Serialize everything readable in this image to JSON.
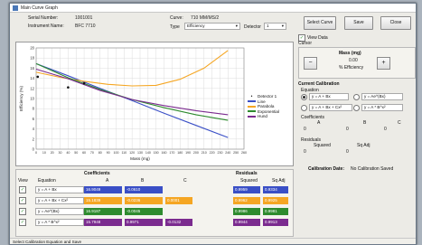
{
  "window": {
    "title": "Main Curve Graph"
  },
  "header": {
    "serial_label": "Serial Number:",
    "serial_value": "1001001",
    "instrument_label": "Instrument Name:",
    "instrument_value": "BFC 7710",
    "curve_label": "Curve:",
    "curve_value": "710 MM/MS/2",
    "type_label": "Type",
    "type_value": "Efficiency",
    "detector_label": "Detector",
    "detector_value": "1"
  },
  "toolbar": {
    "select_curve": "Select Curve",
    "save": "Save",
    "close": "Close"
  },
  "view": {
    "view_data_label": "View Data",
    "cursor_label": "Cursor",
    "mass_label": "Mass (mg)",
    "mass_value": "0.00",
    "efficiency_label": "% Efficiency",
    "minus": "−",
    "plus": "+"
  },
  "calibration": {
    "heading": "Current Calibration",
    "equation_label": "Equation",
    "options": [
      "y = A + Bx",
      "y = Ae^(Bx)",
      "y = A + Bx + Cx²",
      "y = A * B^x²"
    ],
    "coefficients_label": "Coefficients",
    "coef_headers": [
      "A",
      "B",
      "C"
    ],
    "coef_values": [
      "0",
      "0",
      "0"
    ],
    "residuals_label": "Residuals",
    "squared_label": "Squared",
    "sqadj_label": "Sq Adj",
    "squared_value": "0",
    "sqadj_value": "0",
    "date_label": "Calibration Date:",
    "date_value": "No Calibration Saved"
  },
  "table": {
    "coefficients_heading": "Coefficients",
    "residuals_heading": "Residuals",
    "col_view": "View",
    "col_equation": "Equation",
    "col_a": "A",
    "col_b": "B",
    "col_c": "C",
    "col_squared": "Squared",
    "col_sqadj": "Sq Adj",
    "rows": [
      {
        "equation": "y = A + Bx",
        "color": "#3a4fc6",
        "a": "16.9049",
        "b": "-0.0610",
        "c": "",
        "squared": "0.9959",
        "sqadj": "0.9334"
      },
      {
        "equation": "y = A + Bx + Cx²",
        "color": "#f5a623",
        "a": "15.1839",
        "b": "-0.0236",
        "c": "0.0001",
        "squared": "0.9962",
        "sqadj": "0.9925"
      },
      {
        "equation": "y = Ae^(Bx)",
        "color": "#2e8b2e",
        "a": "16.9187",
        "b": "-0.0045",
        "c": "",
        "squared": "0.9986",
        "sqadj": "0.9981"
      },
      {
        "equation": "y = A * B^x²",
        "color": "#7b2b8f",
        "a": "15.7948",
        "b": "0.9971",
        "c": "-0.0132",
        "squared": "0.9944",
        "sqadj": "0.9913"
      }
    ]
  },
  "status": {
    "text": "Select Calibration Equation and Save"
  },
  "chart_data": {
    "type": "line",
    "xlabel": "Mass (mg)",
    "ylabel": "Efficiency (%)",
    "xlim": [
      0,
      260
    ],
    "ylim": [
      0,
      20
    ],
    "xticks": [
      0,
      10,
      20,
      30,
      40,
      50,
      60,
      70,
      80,
      90,
      100,
      110,
      120,
      130,
      140,
      150,
      160,
      170,
      180,
      190,
      200,
      210,
      220,
      230,
      240,
      250,
      260
    ],
    "yticks": [
      0,
      2,
      4,
      6,
      8,
      10,
      12,
      14,
      16,
      18,
      20
    ],
    "grid": true,
    "legend_position": "right",
    "points": {
      "name": "Detector 1",
      "x": [
        2,
        40,
        60
      ],
      "y": [
        14.3,
        12.2,
        13.0
      ]
    },
    "series": [
      {
        "name": "Line",
        "color": "#3a4fc6",
        "x": [
          0,
          40,
          80,
          120,
          160,
          200,
          240
        ],
        "y": [
          16.9,
          14.5,
          12.0,
          9.6,
          7.1,
          4.7,
          2.3
        ]
      },
      {
        "name": "Parabola",
        "color": "#f5a623",
        "x": [
          0,
          30,
          60,
          90,
          120,
          150,
          180,
          210,
          240
        ],
        "y": [
          15.2,
          14.2,
          13.4,
          12.8,
          12.5,
          12.6,
          13.8,
          16.0,
          19.5
        ]
      },
      {
        "name": "Exponential",
        "color": "#2e8b2e",
        "x": [
          0,
          40,
          80,
          120,
          160,
          200,
          240
        ],
        "y": [
          16.9,
          14.1,
          11.8,
          9.8,
          8.2,
          6.8,
          5.7
        ]
      },
      {
        "name": "Hund",
        "color": "#7b2b8f",
        "x": [
          0,
          40,
          80,
          120,
          160,
          200,
          240
        ],
        "y": [
          15.8,
          13.9,
          11.6,
          9.8,
          8.6,
          7.6,
          6.8
        ]
      }
    ]
  }
}
